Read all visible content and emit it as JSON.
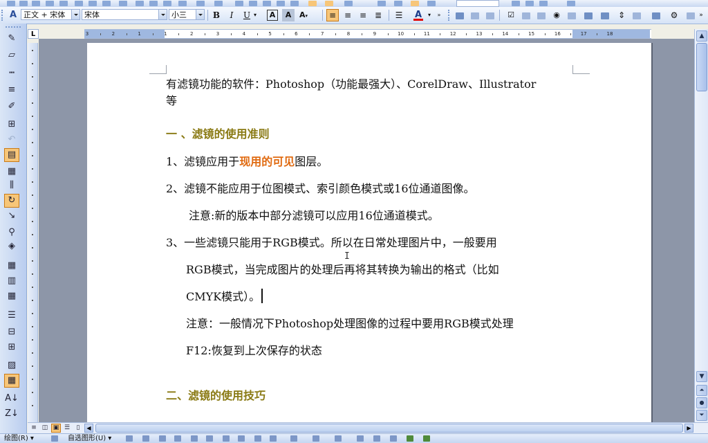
{
  "toolbar": {
    "style_value": "正文 + 宋体",
    "font_value": "宋体",
    "size_value": "小三",
    "bold_label": "B",
    "italic_label": "I",
    "underline_label": "U",
    "font_color_label": "A",
    "char_border_label": "A",
    "char_shade_label": "A",
    "highlight_color": "#ffff00",
    "font_color": "#e00000"
  },
  "ruler": {
    "corner_label": "L",
    "numbers": [
      "3",
      "2",
      "1",
      "1",
      "2",
      "3",
      "4",
      "5",
      "6",
      "7",
      "8",
      "9",
      "10",
      "11",
      "12",
      "13",
      "14",
      "15",
      "16",
      "17",
      "18"
    ]
  },
  "document": {
    "line1": "有滤镜功能的软件：Photoshop（功能最强大）、CorelDraw、Illustrator",
    "line2": "等",
    "heading1": "一 、滤镜的使用准则",
    "item1_prefix": "1、滤镜应用于",
    "item1_highlight": "现用的可见",
    "item1_suffix": "图层。",
    "item2": "2、滤镜不能应用于位图模式、索引颜色模式或16位通道图像。",
    "note1": "注意:新的版本中部分滤镜可以应用16位通道模式。",
    "item3_line1": "3、一些滤镜只能用于RGB模式。所以在日常处理图片中，一般要用",
    "item3_line2": "RGB模式，当完成图片的处理后再将其转换为输出的格式（比如",
    "item3_line3": "CMYK模式）。",
    "note2": "注意：一般情况下Photoshop处理图像的过程中要用RGB模式处理",
    "note3": "F12:恢复到上次保存的状态",
    "heading2": "二、滤镜的使用技巧",
    "heading_color": "#8a7a14",
    "highlight_color": "#e06a10"
  },
  "drawbar": {
    "draw_label": "绘图(R) ▾",
    "autoshape_label": "自选图形(U) ▾"
  },
  "left_toolbar": {
    "icons": [
      "draw-table-icon",
      "eraser-icon",
      "line-style-icon",
      "line-weight-icon",
      "border-color-icon",
      "borders-icon",
      "undo-icon",
      "text-box-icon",
      "insert-table-icon",
      "distribute-icon",
      "merge-icon",
      "split-icon",
      "zoom-icon",
      "paint-bucket-icon",
      "table-autofit-icon",
      "align-top-icon",
      "align-center-icon",
      "insert-rows-icon",
      "insert-cols-icon",
      "text-direction-icon",
      "autoformat-icon",
      "show-gridlines-icon",
      "sort-ascending-icon",
      "sort-descending-icon"
    ]
  }
}
